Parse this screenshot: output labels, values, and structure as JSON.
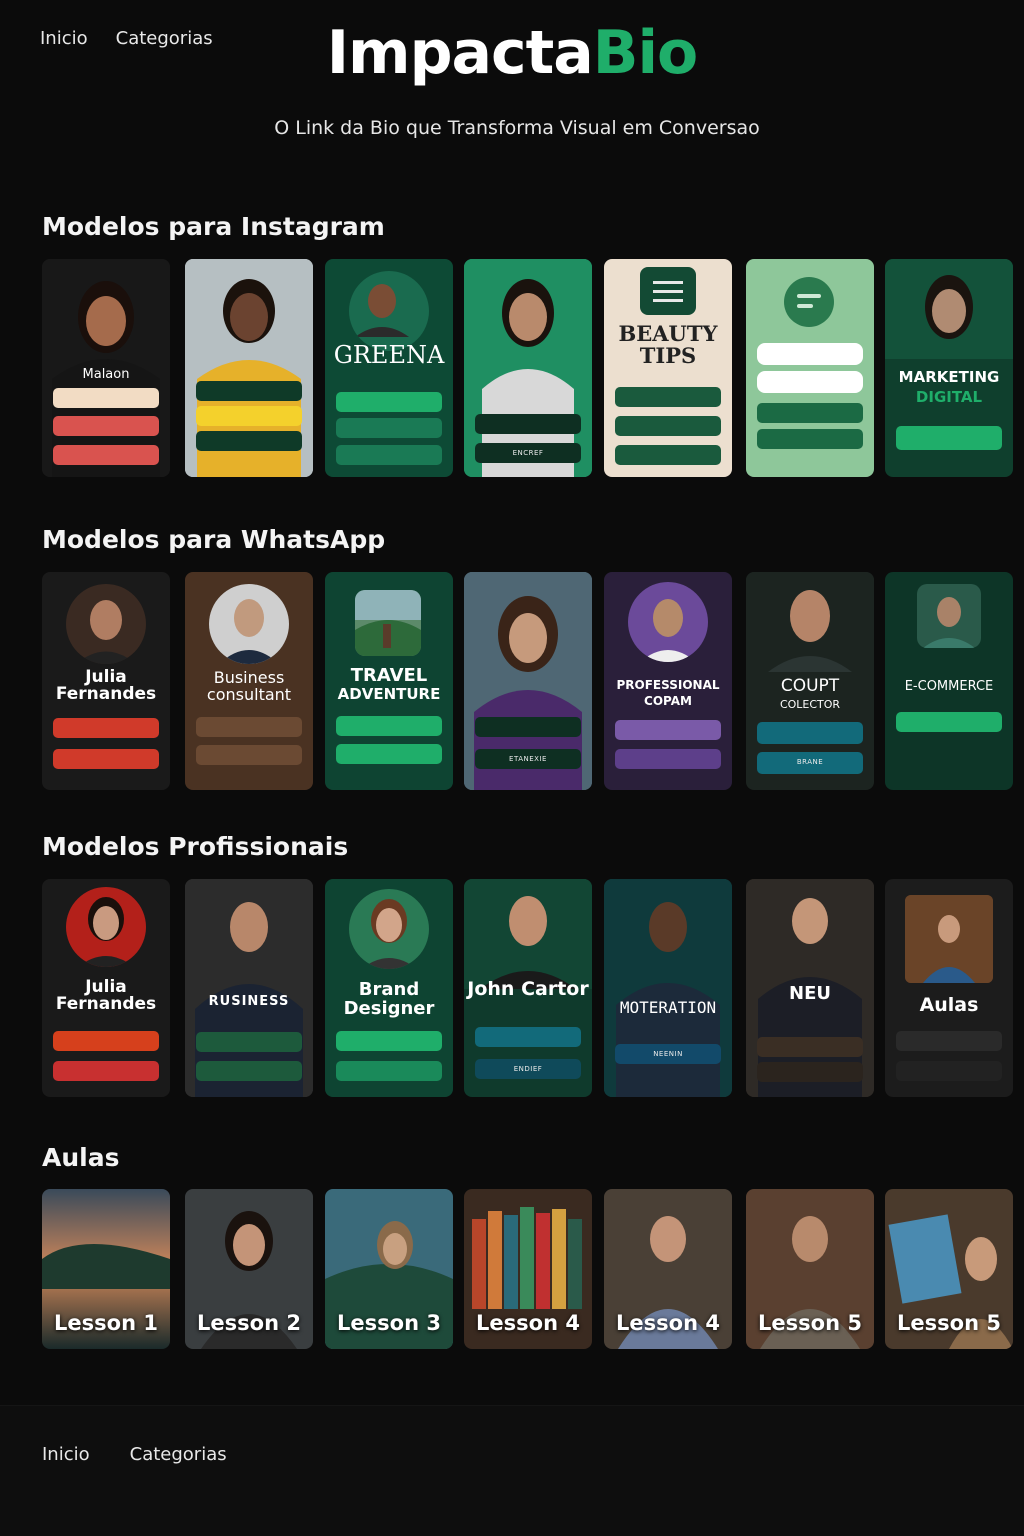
{
  "nav": {
    "home": "Inicio",
    "categories": "Categorias"
  },
  "brand": {
    "part1": "Impacta",
    "part2": "Bio",
    "accent_color": "#1fae6a"
  },
  "tagline": "O Link da Bio que Transforma Visual em Conversao",
  "sections": {
    "instagram": {
      "title": "Modelos para Instagram",
      "cards": [
        {
          "name": "Malaon",
          "buttons": [
            "",
            "",
            ""
          ]
        },
        {
          "name": "",
          "buttons": [
            "",
            "",
            ""
          ]
        },
        {
          "name": "GREENA",
          "buttons": [
            "",
            "",
            ""
          ]
        },
        {
          "name": "",
          "buttons": [
            "",
            "ENCREF"
          ]
        },
        {
          "name": "BEAUTY TIPS",
          "buttons": [
            "",
            "",
            ""
          ]
        },
        {
          "name": "",
          "buttons": [
            "",
            "",
            "",
            ""
          ]
        },
        {
          "name": "MARKETING",
          "name2": "DIGITAL",
          "buttons": [
            ""
          ]
        }
      ]
    },
    "whatsapp": {
      "title": "Modelos para WhatsApp",
      "cards": [
        {
          "name": "Julia Fernandes",
          "buttons": [
            "",
            ""
          ]
        },
        {
          "name": "Business consultant",
          "buttons": [
            "",
            ""
          ]
        },
        {
          "name": "TRAVEL",
          "name2": "ADVENTURE",
          "buttons": [
            "",
            ""
          ]
        },
        {
          "name": "",
          "buttons": [
            "",
            "ETANEXIE"
          ]
        },
        {
          "name": "PROFESSIONAL COPAM",
          "buttons": [
            "",
            ""
          ]
        },
        {
          "name": "COUPT",
          "name2": "COLECTOR",
          "buttons": [
            "",
            "BRANE"
          ]
        },
        {
          "name": "E-COMMERCE",
          "buttons": [
            "",
            ""
          ]
        }
      ]
    },
    "profissionais": {
      "title": "Modelos Profissionais",
      "cards": [
        {
          "name": "Julia Fernandes",
          "buttons": [
            "",
            ""
          ]
        },
        {
          "name": "RUSINESS",
          "buttons": [
            "",
            ""
          ]
        },
        {
          "name": "Brand Designer",
          "buttons": [
            "",
            ""
          ]
        },
        {
          "name": "John Cartor",
          "buttons": [
            "",
            "ENDIEF"
          ]
        },
        {
          "name": "MOTERATION",
          "buttons": [
            "NEENIN"
          ]
        },
        {
          "name": "NEU",
          "buttons": [
            "",
            ""
          ]
        },
        {
          "name": "Aulas",
          "buttons": [
            "",
            ""
          ]
        }
      ]
    },
    "aulas": {
      "title": "Aulas",
      "lessons": [
        "Lesson 1",
        "Lesson 2",
        "Lesson 3",
        "Lesson 4",
        "Lesson 4",
        "Lesson 5",
        "Lesson 5"
      ]
    }
  },
  "footer": {
    "home": "Inicio",
    "categories": "Categorias"
  }
}
